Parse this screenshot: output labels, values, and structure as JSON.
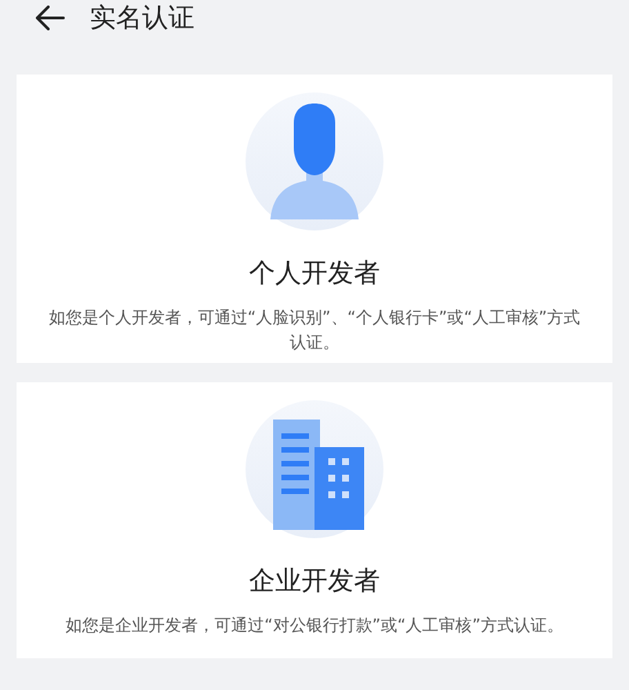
{
  "header": {
    "title": "实名认证"
  },
  "cards": [
    {
      "kind": "person",
      "title": "个人开发者",
      "description": "如您是个人开发者，可通过“人脸识别”、“个人银行卡”或“人工审核”方式认证。"
    },
    {
      "kind": "company",
      "title": "企业开发者",
      "description": "如您是企业开发者，可通过“对公银行打款”或“人工审核”方式认证。"
    }
  ]
}
